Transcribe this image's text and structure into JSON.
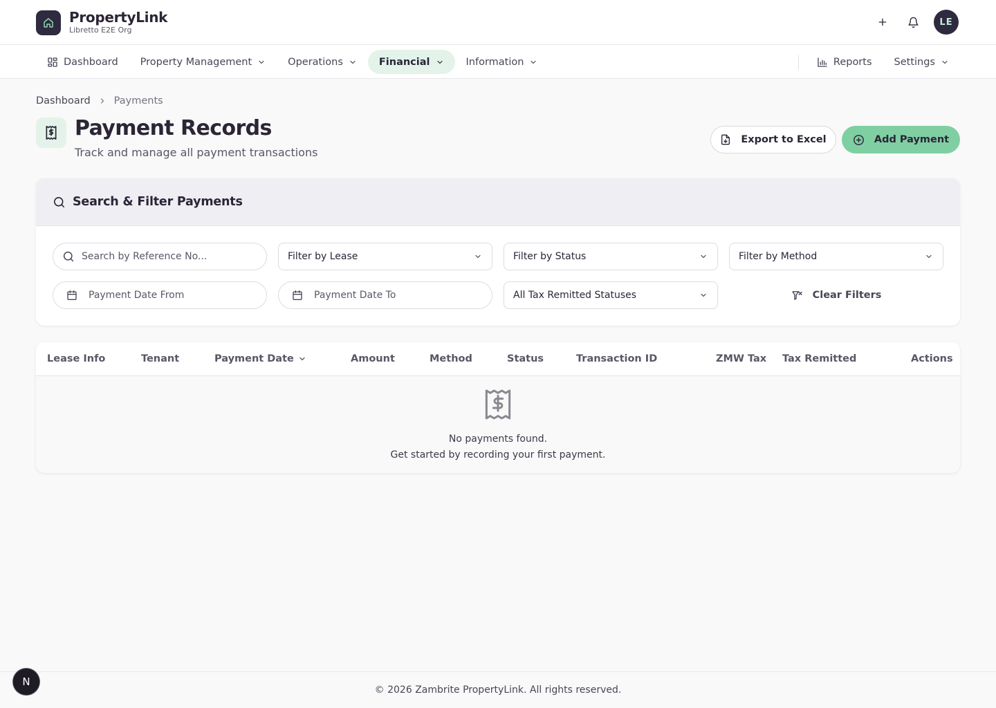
{
  "brand": {
    "name": "PropertyLink",
    "org": "Libretto E2E Org",
    "accent": "#7fcfa3",
    "dark": "#2e2a3f"
  },
  "header": {
    "avatar_initials": "LE",
    "icons": [
      "plus-icon",
      "bell-icon"
    ]
  },
  "nav": {
    "items": [
      {
        "label": "Dashboard",
        "icon": "grid-icon"
      },
      {
        "label": "Property Management"
      },
      {
        "label": "Operations"
      },
      {
        "label": "Financial",
        "active": true
      },
      {
        "label": "Information"
      }
    ],
    "right": [
      {
        "label": "Reports",
        "icon": "bar-chart-icon"
      },
      {
        "label": "Settings"
      }
    ]
  },
  "breadcrumb": {
    "home": "Dashboard",
    "current": "Payments"
  },
  "page": {
    "title": "Payment Records",
    "subtitle": "Track and manage all payment transactions",
    "export_label": "Export to Excel",
    "add_label": "Add Payment"
  },
  "filters": {
    "title": "Search & Filter Payments",
    "search_placeholder": "Search by Reference No...",
    "lease": "Filter by Lease",
    "status": "Filter by Status",
    "method": "Filter by Method",
    "date_from": "Payment Date From",
    "date_to": "Payment Date To",
    "tax_status": "All Tax Remitted Statuses",
    "clear_label": "Clear Filters"
  },
  "table": {
    "columns": [
      "Lease Info",
      "Tenant",
      "Payment Date",
      "Amount",
      "Method",
      "Status",
      "Transaction ID",
      "ZMW Tax",
      "Tax Remitted",
      "Actions"
    ],
    "empty_title": "No payments found.",
    "empty_subtitle": "Get started by recording your first payment."
  },
  "footer": {
    "text": "© 2026 Zambrite PropertyLink. All rights reserved.",
    "badge": "N"
  }
}
